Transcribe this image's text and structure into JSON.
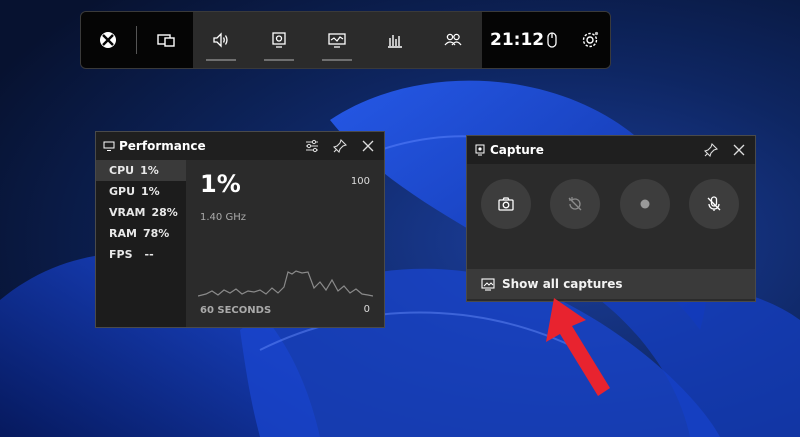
{
  "gamebar": {
    "time": "21:12",
    "icons": [
      "xbox-icon",
      "widget-menu-icon",
      "audio-icon",
      "capture-icon",
      "performance-icon",
      "resources-icon",
      "social-icon",
      "mouse-icon",
      "gear-icon"
    ]
  },
  "performance": {
    "title": "Performance",
    "metrics": [
      {
        "label": "CPU",
        "value": "1%"
      },
      {
        "label": "GPU",
        "value": "1%"
      },
      {
        "label": "VRAM",
        "value": "28%"
      },
      {
        "label": "RAM",
        "value": "78%"
      },
      {
        "label": "FPS",
        "value": "--"
      }
    ],
    "selected": "CPU",
    "current_value": "1%",
    "frequency": "1.40 GHz",
    "graph_max": "100",
    "graph_min": "0",
    "graph_window": "60 SECONDS"
  },
  "capture": {
    "title": "Capture",
    "buttons": [
      "screenshot-icon",
      "record-last-icon",
      "record-icon",
      "mic-off-icon"
    ],
    "show_all_label": "Show all captures"
  },
  "colors": {
    "arrow": "#e8232f",
    "wallpaper_blue": "#1f4fd6"
  }
}
